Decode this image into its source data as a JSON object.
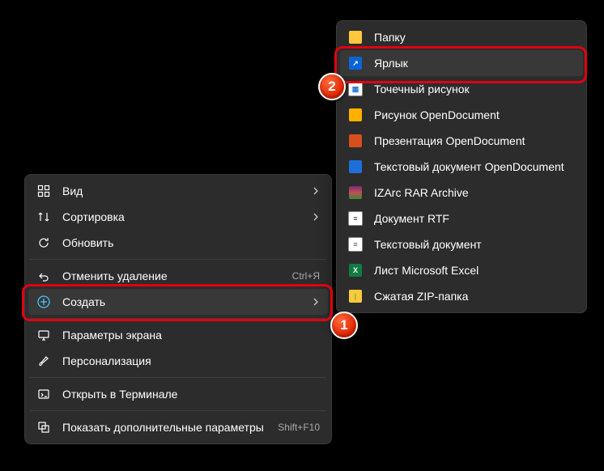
{
  "main_menu": {
    "view": {
      "label": "Вид"
    },
    "sort": {
      "label": "Сортировка"
    },
    "refresh": {
      "label": "Обновить"
    },
    "undo": {
      "label": "Отменить удаление",
      "shortcut": "Ctrl+Я"
    },
    "new": {
      "label": "Создать"
    },
    "display": {
      "label": "Параметры экрана"
    },
    "personal": {
      "label": "Персонализация"
    },
    "terminal": {
      "label": "Открыть в Терминале"
    },
    "more": {
      "label": "Показать дополнительные параметры",
      "shortcut": "Shift+F10"
    }
  },
  "sub_menu": {
    "folder": {
      "label": "Папку"
    },
    "shortcut": {
      "label": "Ярлык"
    },
    "bmp": {
      "label": "Точечный рисунок"
    },
    "odg": {
      "label": "Рисунок OpenDocument"
    },
    "odp": {
      "label": "Презентация OpenDocument"
    },
    "odt": {
      "label": "Текстовый документ OpenDocument"
    },
    "rar": {
      "label": "IZArc RAR Archive"
    },
    "rtf": {
      "label": "Документ RTF"
    },
    "txt": {
      "label": "Текстовый документ"
    },
    "xls": {
      "label": "Лист Microsoft Excel"
    },
    "zip": {
      "label": "Сжатая ZIP-папка"
    }
  },
  "badges": {
    "one": "1",
    "two": "2"
  }
}
